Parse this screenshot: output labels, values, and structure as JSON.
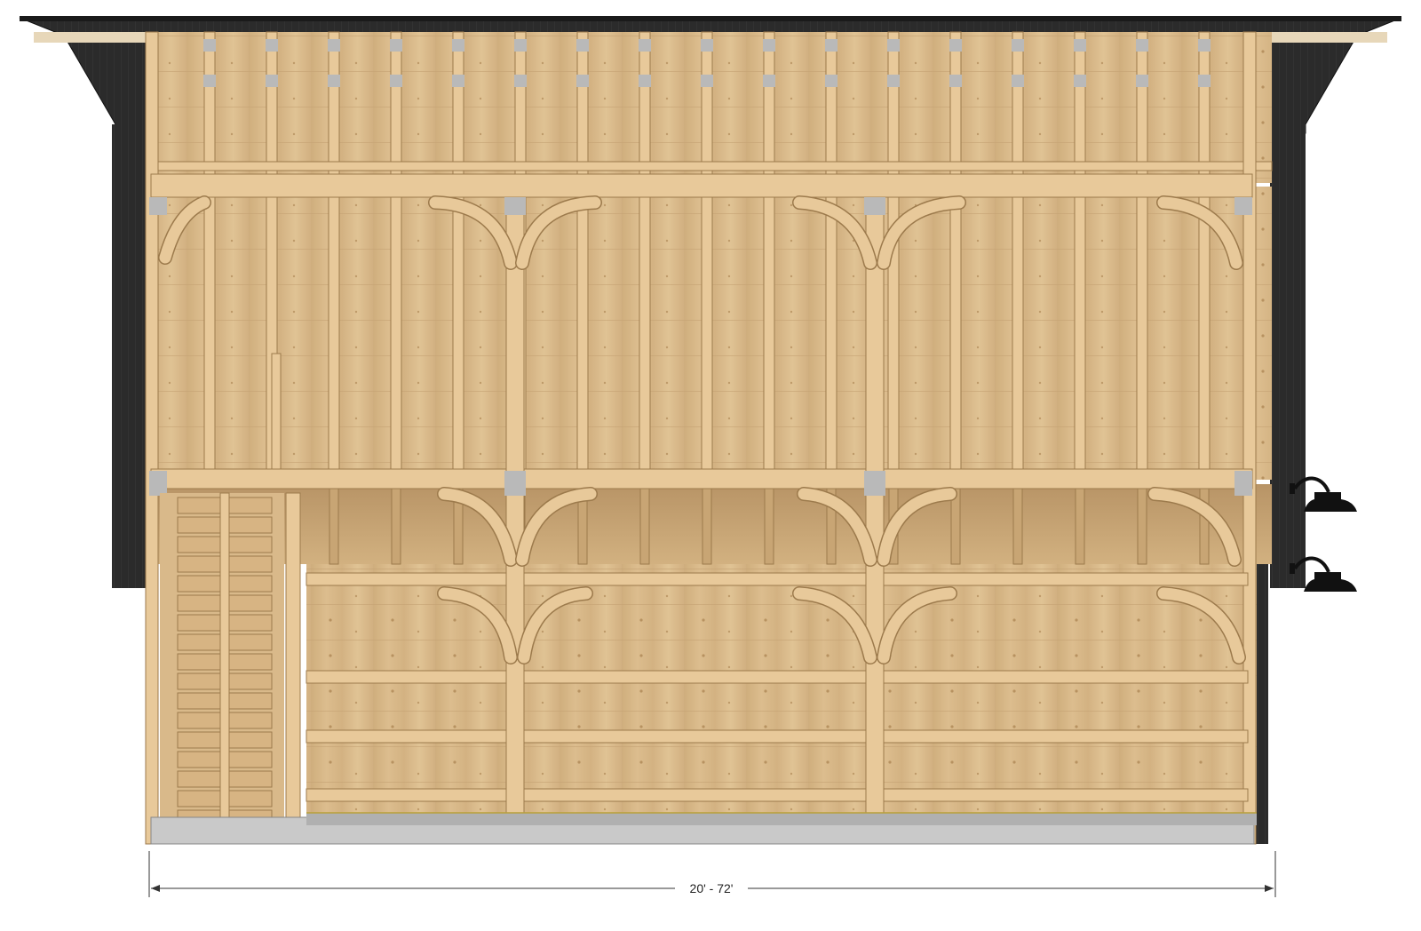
{
  "drawing": {
    "dimension_label": "20' - 72'"
  },
  "colors": {
    "siding": "#2b2b2b",
    "roof_edge": "#1a1a1a",
    "wood_panel": "#d8b887",
    "timber": "#e8c99a",
    "timber_edge": "#9c7a4c",
    "steel_plate": "#b9b9b9",
    "foundation": "#c9c9c9",
    "lamp": "#111111",
    "dimension_line": "#333333"
  },
  "icons": [
    "barn-lamp-icon",
    "barn-lamp-icon"
  ]
}
